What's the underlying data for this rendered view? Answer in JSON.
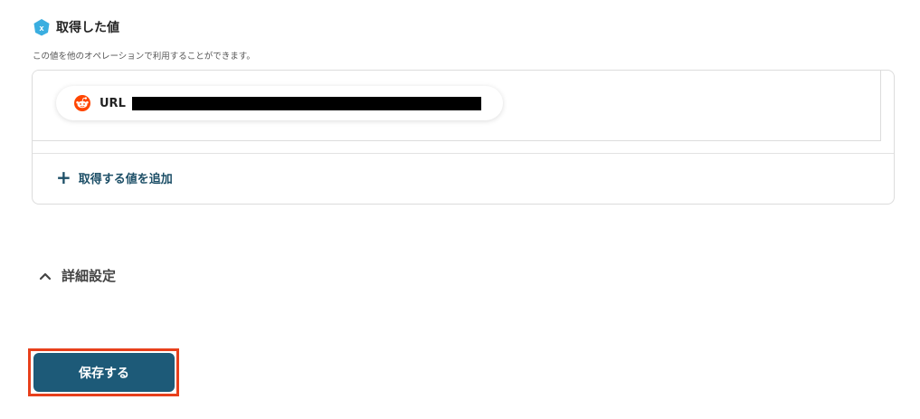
{
  "section": {
    "title": "取得した値",
    "description": "この値を他のオペレーションで利用することができます。",
    "title_icon": "x-badge-icon",
    "accent_color": "#3aaee0"
  },
  "values": {
    "items": [
      {
        "label": "URL",
        "icon": "reddit-icon",
        "value_redacted": true
      }
    ],
    "add_label": "取得する値を追加",
    "add_icon": "plus-icon"
  },
  "advanced": {
    "label": "詳細設定",
    "icon": "chevron-up-icon",
    "expanded": true
  },
  "save_button": {
    "label": "保存する",
    "background": "#1d5a78",
    "highlight_color": "#e8401c"
  }
}
